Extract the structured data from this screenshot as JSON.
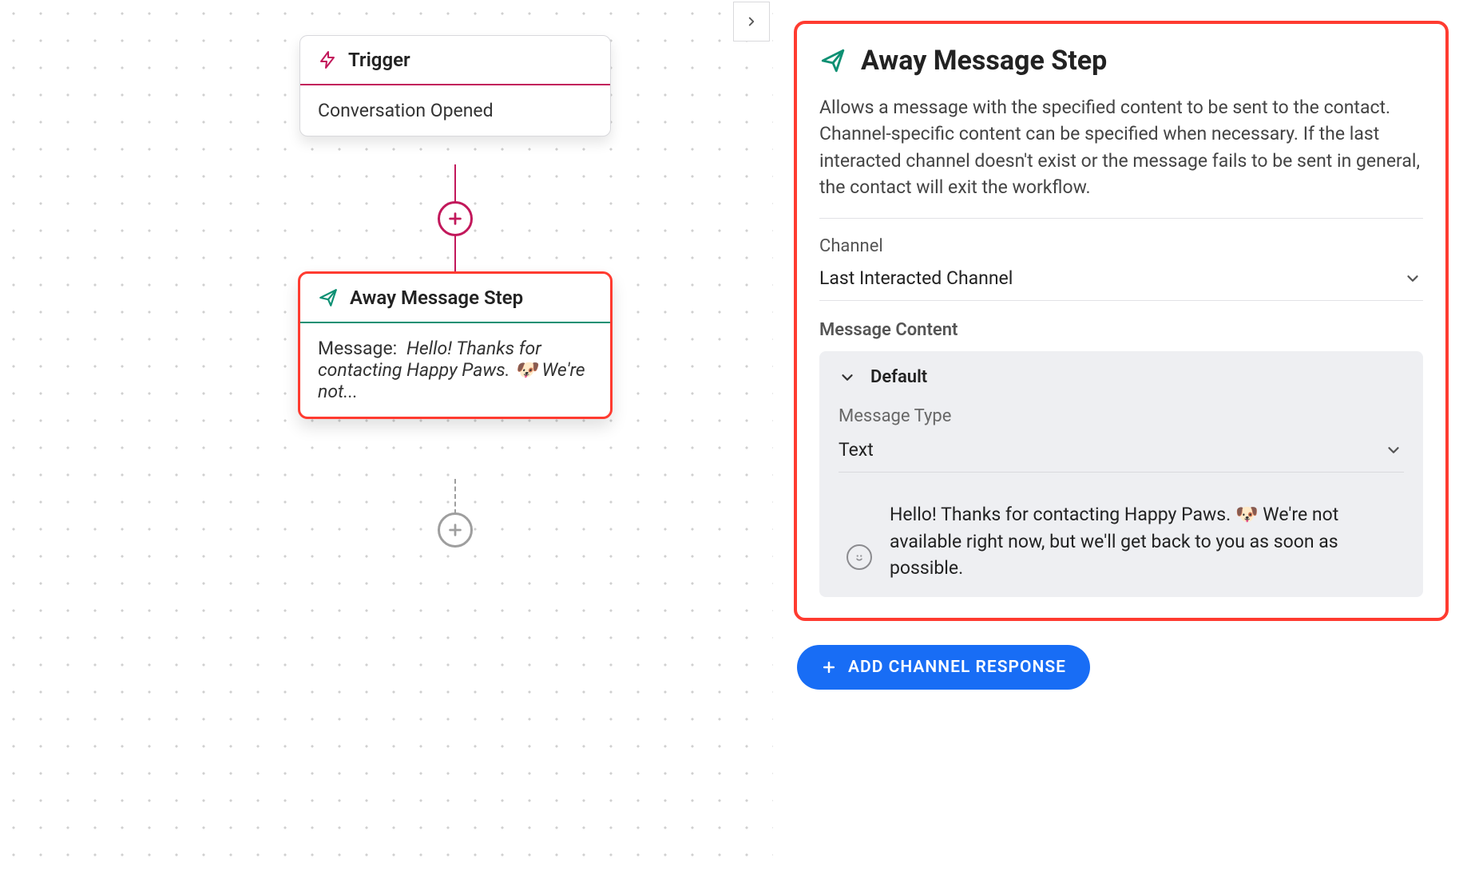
{
  "canvas": {
    "trigger": {
      "title": "Trigger",
      "body": "Conversation Opened"
    },
    "step": {
      "title": "Away Message Step",
      "message_label": "Message:",
      "message_preview": "Hello! Thanks for contacting Happy Paws. 🐶 We're not..."
    }
  },
  "panel": {
    "title": "Away Message Step",
    "description": "Allows a message with the specified content to be sent to the contact. Channel-specific content can be specified when necessary. If the last interacted channel doesn't exist or the message fails to be sent in general, the contact will exit the workflow.",
    "channel_label": "Channel",
    "channel_value": "Last Interacted Channel",
    "content_label": "Message Content",
    "default_label": "Default",
    "msg_type_label": "Message Type",
    "msg_type_value": "Text",
    "message_text": "Hello! Thanks for contacting Happy Paws. 🐶 We're not available right now, but we'll get back to you as soon as possible.",
    "add_channel_label": "ADD CHANNEL RESPONSE"
  }
}
